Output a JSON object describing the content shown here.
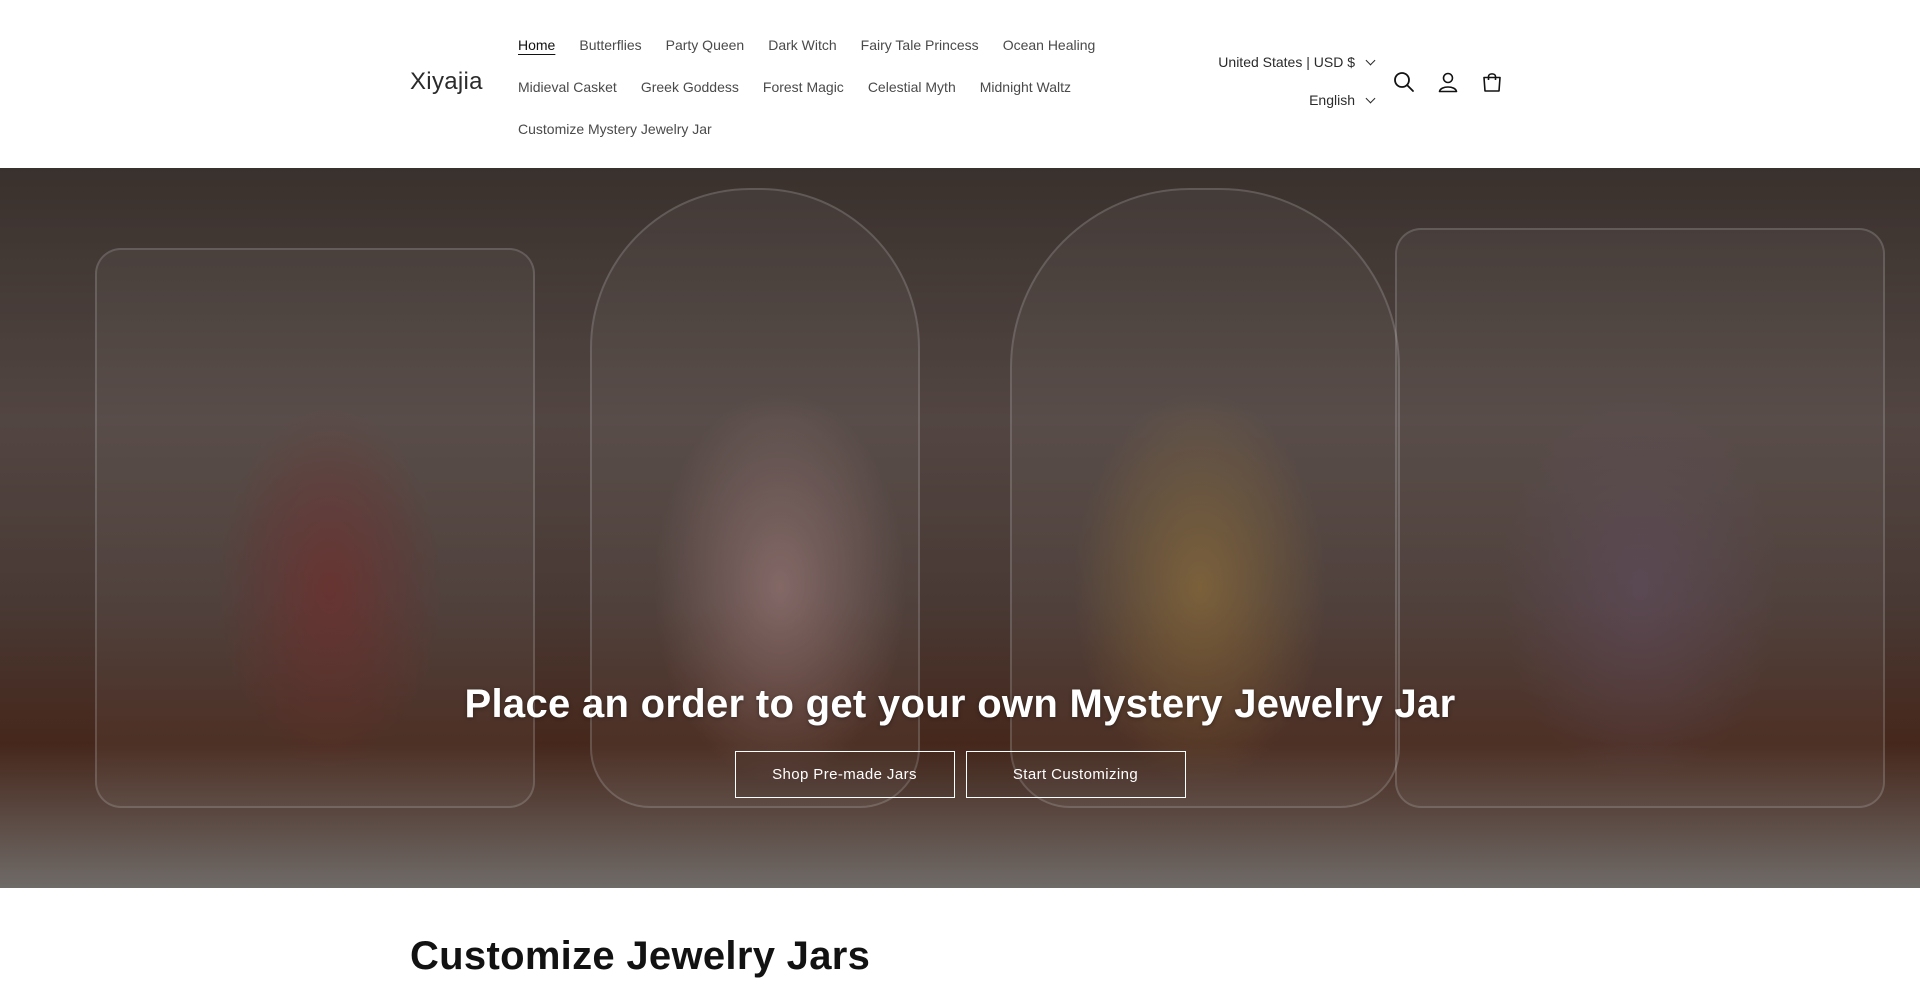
{
  "header": {
    "logo": "Xiyajia",
    "nav": {
      "row1": [
        "Home",
        "Butterflies",
        "Party Queen",
        "Dark Witch",
        "Fairy Tale Princess",
        "Ocean Healing"
      ],
      "row2": [
        "Midieval Casket",
        "Greek Goddess",
        "Forest Magic",
        "Celestial Myth",
        "Midnight Waltz"
      ],
      "row3": [
        "Customize Mystery Jewelry Jar"
      ]
    },
    "country_selector": "United States | USD $",
    "language_selector": "English",
    "icons": [
      "search-icon",
      "account-icon",
      "cart-icon"
    ]
  },
  "hero": {
    "title": "Place an order to get your own Mystery Jewelry Jar",
    "primary_button": "Shop Pre-made Jars",
    "secondary_button": "Start Customizing"
  },
  "section": {
    "title": "Customize Jewelry Jars"
  },
  "colors": {
    "text": "#121212",
    "hero_text": "#ffffff"
  }
}
